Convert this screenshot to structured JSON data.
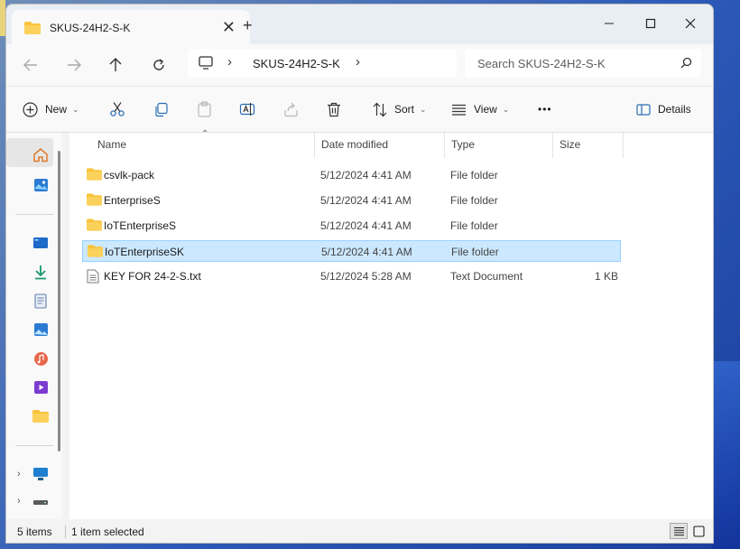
{
  "window": {
    "tab_title": "SKUS-24H2-S-K",
    "new_tab_glyph": "+",
    "close_glyph": "✕",
    "controls": {
      "minimize": "—",
      "maximize": "☐",
      "close": "✕"
    }
  },
  "address": {
    "path": "SKUS-24H2-S-K",
    "search_placeholder": "Search SKUS-24H2-S-K"
  },
  "toolbar": {
    "new_label": "New",
    "sort_label": "Sort",
    "view_label": "View",
    "more_label": "•••",
    "details_label": "Details"
  },
  "columns": {
    "name": "Name",
    "date": "Date modified",
    "type": "Type",
    "size": "Size"
  },
  "files": [
    {
      "name": "csvlk-pack",
      "date": "5/12/2024 4:41 AM",
      "type": "File folder",
      "size": "",
      "icon": "folder-icon"
    },
    {
      "name": "EnterpriseS",
      "date": "5/12/2024 4:41 AM",
      "type": "File folder",
      "size": "",
      "icon": "folder-icon"
    },
    {
      "name": "IoTEnterpriseS",
      "date": "5/12/2024 4:41 AM",
      "type": "File folder",
      "size": "",
      "icon": "folder-icon"
    },
    {
      "name": "IoTEnterpriseSK",
      "date": "5/12/2024 4:41 AM",
      "type": "File folder",
      "size": "",
      "icon": "folder-icon",
      "selected": true
    },
    {
      "name": "KEY FOR 24-2-S.txt",
      "date": "5/12/2024 5:28 AM",
      "type": "Text Document",
      "size": "1 KB",
      "icon": "text-file-icon"
    }
  ],
  "status": {
    "item_count": "5 items",
    "selection": "1 item selected"
  },
  "colors": {
    "selection_bg": "#cce8ff",
    "selection_border": "#99d1ff",
    "folder": "#f8c43c",
    "accent": "#0067c0"
  }
}
